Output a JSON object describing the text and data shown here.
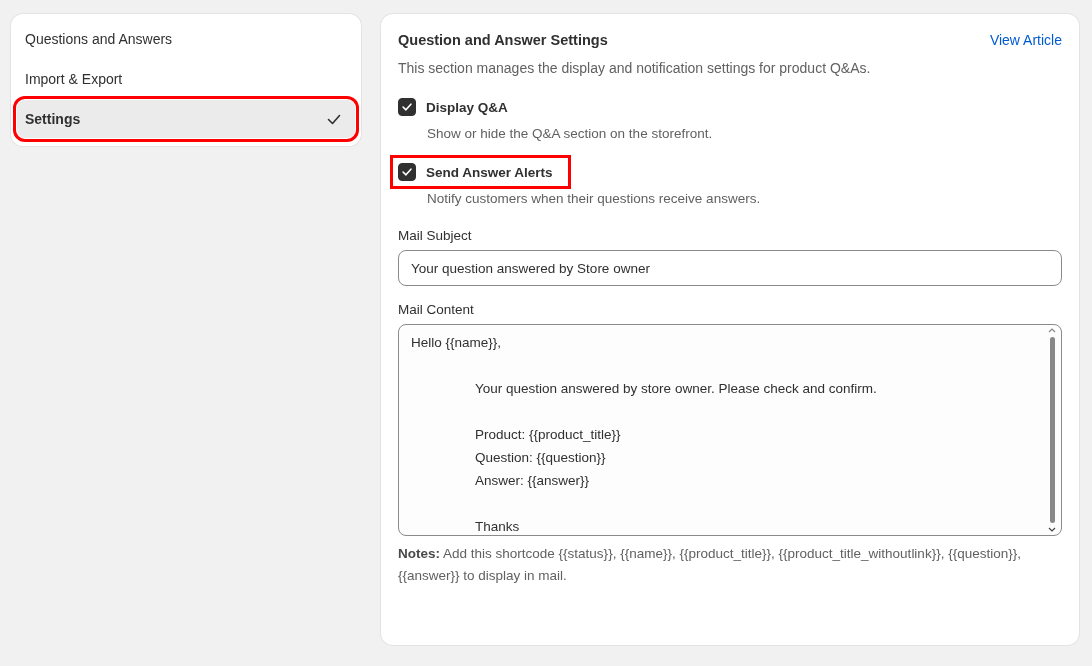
{
  "sidebar": {
    "items": [
      {
        "label": "Questions and Answers",
        "selected": false,
        "highlighted": false
      },
      {
        "label": "Import & Export",
        "selected": false,
        "highlighted": false
      },
      {
        "label": "Settings",
        "selected": true,
        "highlighted": true
      }
    ]
  },
  "settings": {
    "title": "Question and Answer Settings",
    "link": "View Article",
    "description": "This section manages the display and notification settings for product Q&As.",
    "options": [
      {
        "label": "Display Q&A",
        "help": "Show or hide the Q&A section on the storefront.",
        "checked": true,
        "highlighted": false
      },
      {
        "label": "Send Answer Alerts",
        "help": "Notify customers when their questions receive answers.",
        "checked": true,
        "highlighted": true
      }
    ],
    "mail_subject": {
      "label": "Mail Subject",
      "value": "Your question answered by Store owner"
    },
    "mail_content": {
      "label": "Mail Content",
      "value": "Hello {{name}},\n\n\tYour question answered by store owner. Please check and confirm.\n\n\tProduct: {{product_title}}\n\tQuestion: {{question}}\n\tAnswer: {{answer}}\n\n\tThanks"
    },
    "notes": "**Notes:** Add this shortcode {{status}}, {{name}}, {{product_title}}, {{product_title_withoutlink}}, {{question}}, {{answer}} to display in mail."
  }
}
